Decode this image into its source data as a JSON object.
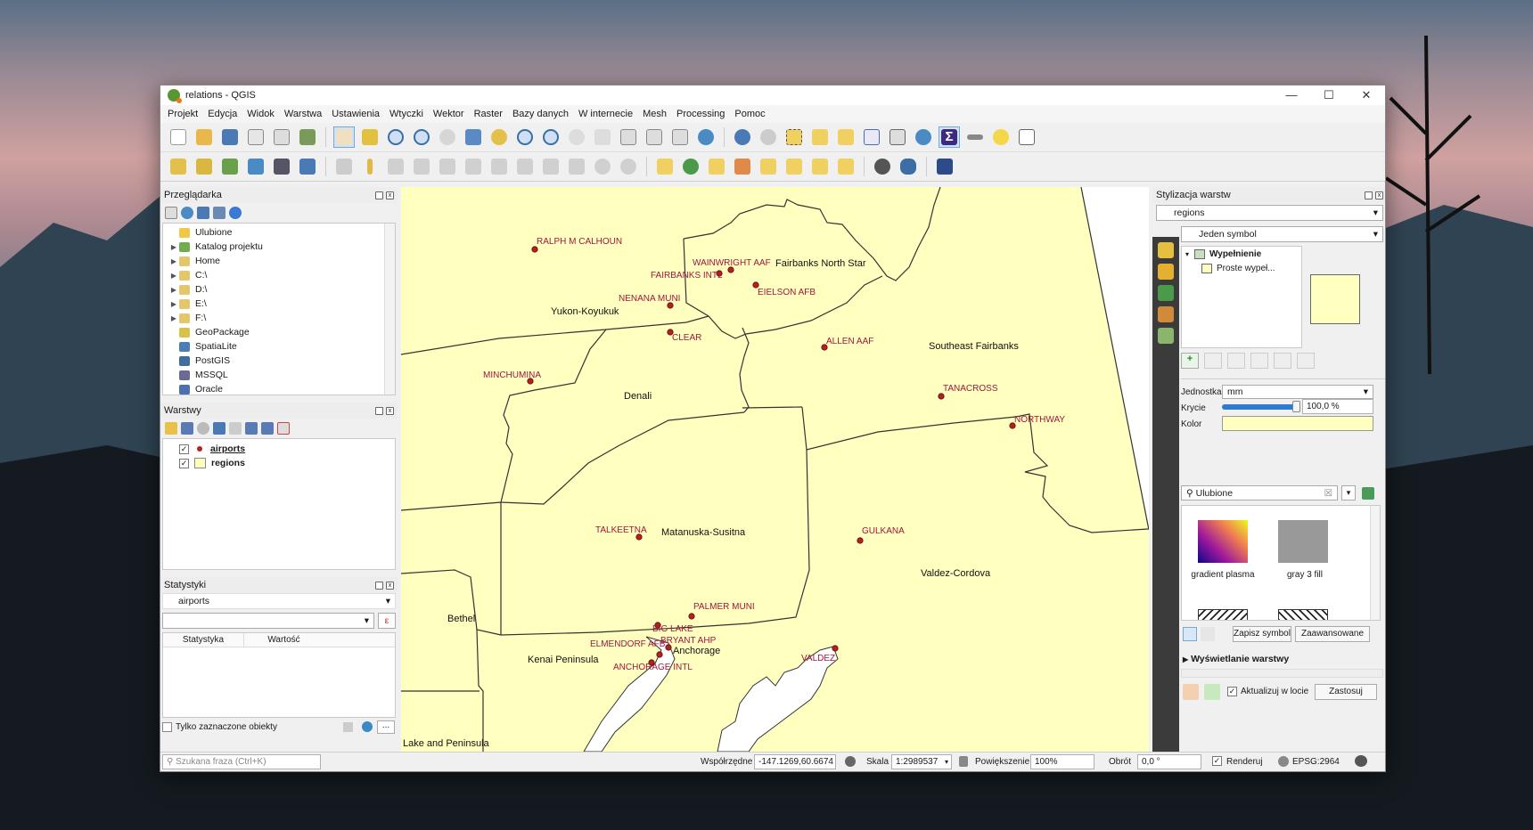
{
  "window": {
    "title": "relations - QGIS"
  },
  "menu": [
    "Projekt",
    "Edycja",
    "Widok",
    "Warstwa",
    "Ustawienia",
    "Wtyczki",
    "Wektor",
    "Raster",
    "Bazy danych",
    "W internecie",
    "Mesh",
    "Processing",
    "Pomoc"
  ],
  "browser": {
    "title": "Przeglądarka",
    "items": [
      {
        "label": "Ulubione",
        "icon": "star-icon",
        "color": "#f2c744",
        "arrow": false
      },
      {
        "label": "Katalog projektu",
        "icon": "project-folder-icon",
        "color": "#6fae4f",
        "arrow": true
      },
      {
        "label": "Home",
        "icon": "folder-icon",
        "color": "#e6c66a",
        "arrow": true
      },
      {
        "label": "C:\\",
        "icon": "drive-icon",
        "color": "#e6c66a",
        "arrow": true
      },
      {
        "label": "D:\\",
        "icon": "drive-icon",
        "color": "#e6c66a",
        "arrow": true
      },
      {
        "label": "E:\\",
        "icon": "drive-icon",
        "color": "#e6c66a",
        "arrow": true
      },
      {
        "label": "F:\\",
        "icon": "drive-icon",
        "color": "#e6c66a",
        "arrow": true
      },
      {
        "label": "GeoPackage",
        "icon": "geopackage-icon",
        "color": "#d9c24a",
        "arrow": false
      },
      {
        "label": "SpatiaLite",
        "icon": "spatialite-icon",
        "color": "#4a7fb5",
        "arrow": false
      },
      {
        "label": "PostGIS",
        "icon": "postgis-icon",
        "color": "#3f6e9e",
        "arrow": false
      },
      {
        "label": "MSSQL",
        "icon": "mssql-icon",
        "color": "#6a6a9a",
        "arrow": false
      },
      {
        "label": "Oracle",
        "icon": "oracle-icon",
        "color": "#4a70b0",
        "arrow": false
      }
    ]
  },
  "layers": {
    "title": "Warstwy",
    "items": [
      {
        "label": "airports",
        "checked": true,
        "icon": "point-layer-icon",
        "color": "#b5201f"
      },
      {
        "label": "regions",
        "checked": true,
        "icon": "polygon-layer-icon",
        "color": "#ffffc0"
      }
    ]
  },
  "stats": {
    "title": "Statystyki",
    "layer": "airports",
    "col_stat": "Statystyka",
    "col_val": "Wartość",
    "only_selected": "Tylko zaznaczone obiekty"
  },
  "search_placeholder": "Szukana fraza (Ctrl+K)",
  "map": {
    "region_labels": [
      "Fairbanks North Star",
      "Yukon-Koyukuk",
      "Southeast Fairbanks",
      "Denali",
      "Matanuska-Susitna",
      "Valdez-Cordova",
      "Bethel",
      "Kenai Peninsula",
      "Anchorage",
      "Lake and Peninsula"
    ],
    "airports": [
      "RALPH M CALHOUN",
      "WAINWRIGHT AAF",
      "FAIRBANKS INTL",
      "EIELSON AFB",
      "NENANA MUNI",
      "CLEAR",
      "ALLEN AAF",
      "MINCHUMINA",
      "TANACROSS",
      "NORTHWAY",
      "TALKEETNA",
      "GULKANA",
      "PALMER MUNI",
      "BIG LAKE",
      "BRYANT AHP",
      "ELMENDORF AFB",
      "ANCHORAGE INTL",
      "VALDEZ"
    ],
    "fill_color": "#ffffc0",
    "point_color": "#b5201f",
    "label_color": "#a0163e"
  },
  "styling": {
    "title": "Stylizacja warstw",
    "layer": "regions",
    "renderer": "Jeden symbol",
    "tree_fill": "Wypełnienie",
    "tree_simple": "Proste wypeł...",
    "unit_label": "Jednostka",
    "unit_value": "mm",
    "opacity_label": "Krycie",
    "opacity_value": "100,0 %",
    "opacity": 1.0,
    "color_label": "Kolor",
    "color_value": "#ffffc0",
    "search_value": "Ulubione",
    "symbols": [
      {
        "label": "gradient plasma"
      },
      {
        "label": "gray 3 fill"
      }
    ],
    "save_symbol": "Zapisz symbol",
    "advanced": "Zaawansowane",
    "layer_rendering": "Wyświetlanie warstwy",
    "live_update": "Aktualizuj w locie",
    "apply": "Zastosuj"
  },
  "statusbar": {
    "coords_label": "Współrzędne",
    "coords": "-147.1269,60.6674",
    "scale_label": "Skala",
    "scale": "1:2989537",
    "magnifier_label": "Powiększenie",
    "magnifier": "100%",
    "rotation_label": "Obrót",
    "rotation": "0,0 °",
    "render_label": "Renderuj",
    "crs": "EPSG:2964"
  }
}
